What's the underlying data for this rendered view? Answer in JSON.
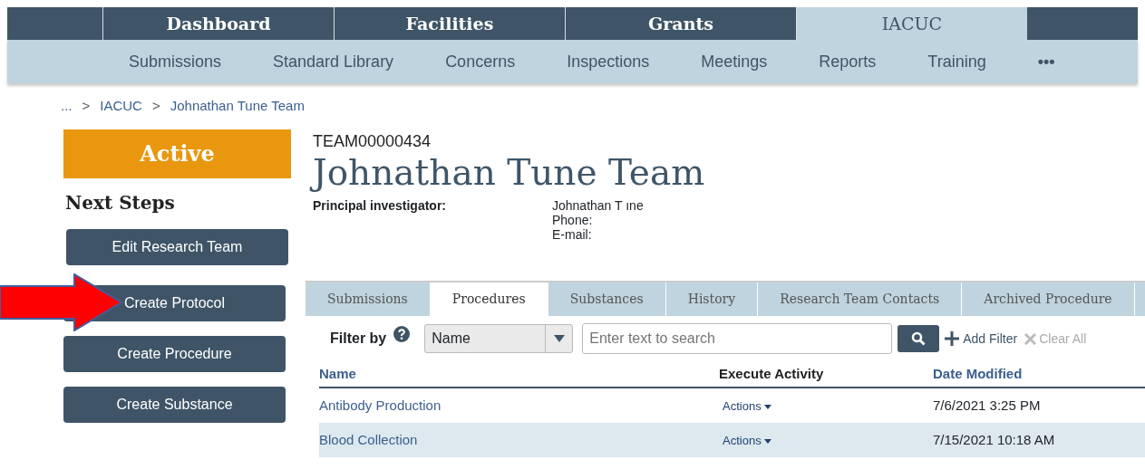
{
  "top_nav": [
    {
      "label": "Dashboard",
      "selected": false
    },
    {
      "label": "Facilities",
      "selected": false
    },
    {
      "label": "Grants",
      "selected": false
    },
    {
      "label": "IACUC",
      "selected": true
    }
  ],
  "sub_nav": [
    "Submissions",
    "Standard Library",
    "Concerns",
    "Inspections",
    "Meetings",
    "Reports",
    "Training",
    "•••"
  ],
  "breadcrumb": [
    {
      "text": "...",
      "kind": "link"
    },
    {
      "text": ">",
      "kind": "separator"
    },
    {
      "text": "IACUC",
      "kind": "link"
    },
    {
      "text": ">",
      "kind": "separator"
    },
    {
      "text": "Johnathan Tune Team",
      "kind": "link"
    }
  ],
  "status": "Active",
  "next_steps": {
    "title": "Next Steps",
    "buttons": [
      "Edit Research Team",
      "Create Protocol",
      "Create Procedure",
      "Create Substance"
    ]
  },
  "team_id": "TEAM00000434",
  "title": "Johnathan Tune Team",
  "pi": {
    "label": "Principal investigator:",
    "name": "Johnathan T ıne",
    "phone_label": "Phone:",
    "email_label": "E-mail:"
  },
  "tabs": [
    {
      "label": "Submissions",
      "selected": false
    },
    {
      "label": "Procedures",
      "selected": true
    },
    {
      "label": "Substances",
      "selected": false
    },
    {
      "label": "History",
      "selected": false
    },
    {
      "label": "Research Team Contacts",
      "selected": false
    },
    {
      "label": "Archived Procedure",
      "selected": false
    }
  ],
  "filter": {
    "label": "Filter by",
    "select_value": "Name",
    "placeholder": "Enter text to search",
    "add_filter": "Add Filter",
    "clear_all": {
      "label": "Clear All",
      "disabled": true
    }
  },
  "table": {
    "columns": [
      "Name",
      "Execute Activity",
      "Date Modified"
    ],
    "rows": [
      {
        "name": "Antibody Production",
        "action": "Actions",
        "date": "7/6/2021 3:25 PM"
      },
      {
        "name": "Blood Collection",
        "action": "Actions",
        "date": "7/15/2021 10:18 AM"
      }
    ]
  }
}
